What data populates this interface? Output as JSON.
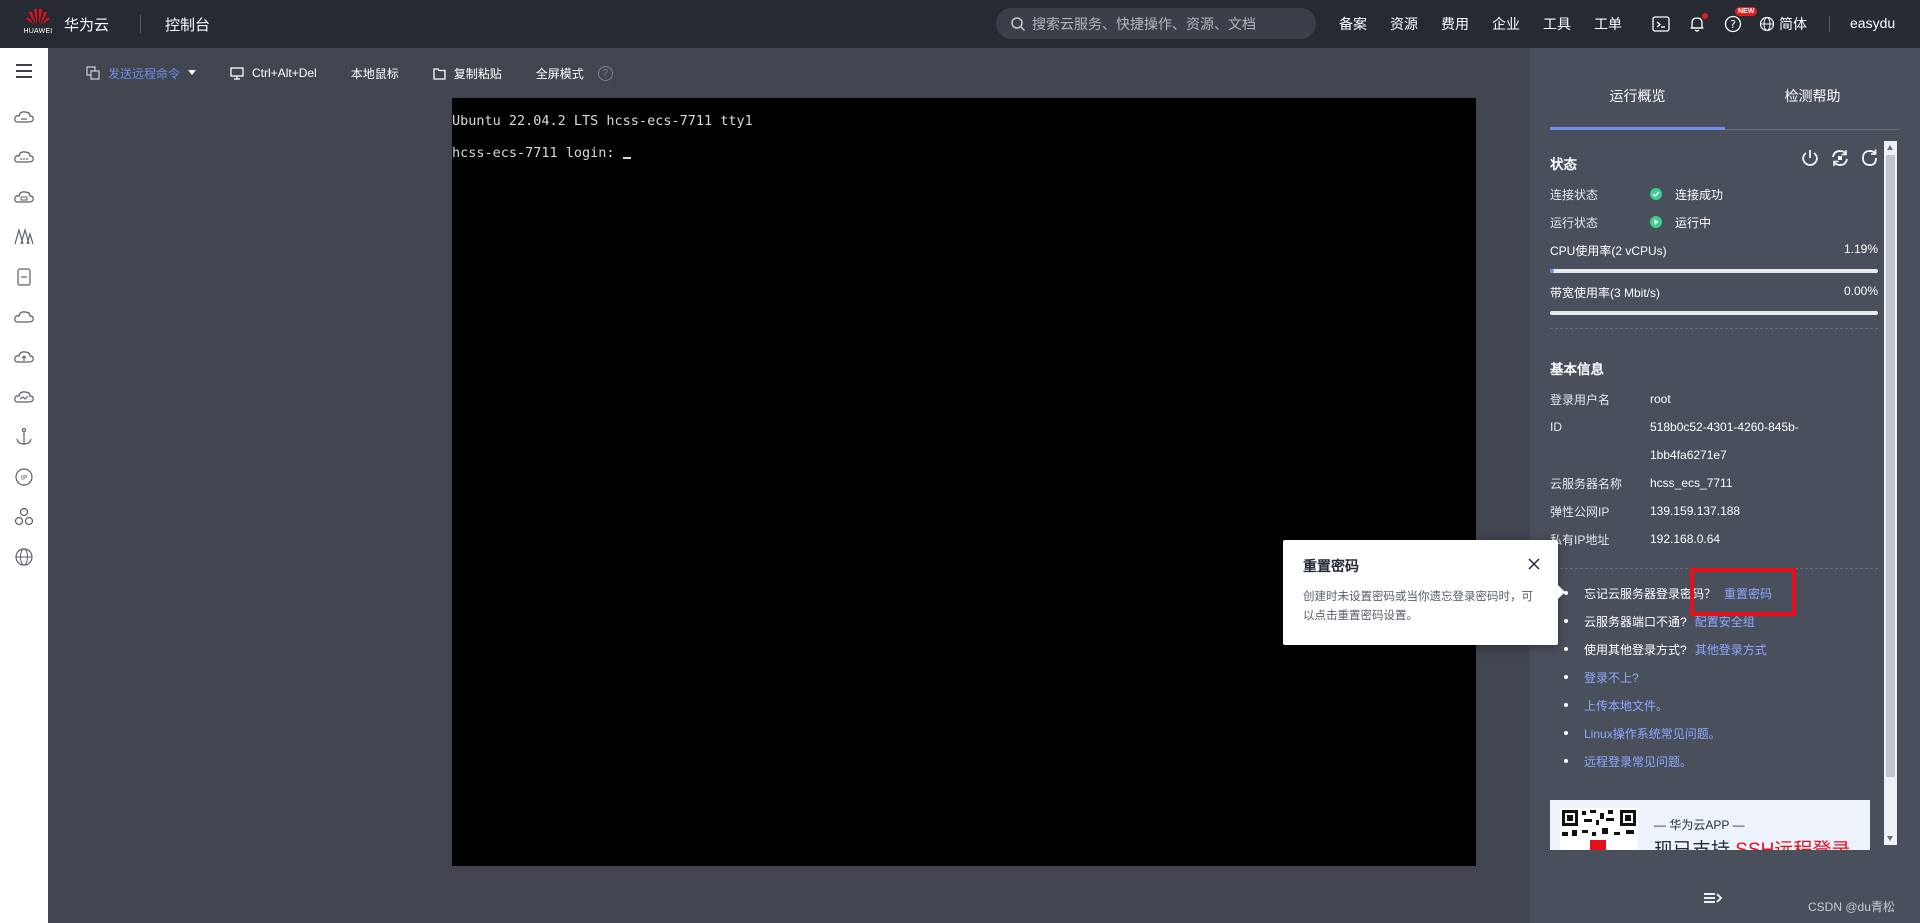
{
  "topbar": {
    "logo_word": "HUAWEI",
    "brand": "华为云",
    "console": "控制台",
    "search_placeholder": "搜索云服务、快捷操作、资源、文档",
    "nav": [
      "备案",
      "资源",
      "费用",
      "企业",
      "工具",
      "工单"
    ],
    "new_badge": "NEW",
    "language": "简体",
    "user": "easydu",
    "icons": [
      "terminal-icon",
      "bell-icon",
      "help-icon",
      "globe-icon"
    ]
  },
  "sidebar": {
    "icons": [
      "menu-icon",
      "cloud-server-icon",
      "cloud-icon",
      "cloud-container-icon",
      "network-icon",
      "storage-icon",
      "cloud-outline-icon",
      "cloud-upload-icon",
      "cloud-monitor-icon",
      "anchor-icon",
      "ip-icon",
      "cluster-icon",
      "globe-icon"
    ]
  },
  "toolbar": {
    "send_command": "发送远程命令",
    "ctrl_alt_del": "Ctrl+Alt+Del",
    "local_mouse": "本地鼠标",
    "copy_paste": "复制粘贴",
    "fullscreen": "全屏模式",
    "help": "?"
  },
  "terminal": {
    "line1": "Ubuntu 22.04.2 LTS hcss-ecs-7711 tty1",
    "line2": "hcss-ecs-7711 login: "
  },
  "popover": {
    "title": "重置密码",
    "text": "创建时未设置密码或当你遗忘登录密码时，可以点击重置密码设置。"
  },
  "panel": {
    "tabs": [
      "运行概览",
      "检测帮助"
    ],
    "status": {
      "title": "状态",
      "connection_label": "连接状态",
      "connection_value": "连接成功",
      "run_label": "运行状态",
      "run_value": "运行中",
      "cpu_label": "CPU使用率(2 vCPUs)",
      "cpu_value": "1.19%",
      "cpu_fraction": 0.0119,
      "bw_label": "带宽使用率(3 Mbit/s)",
      "bw_value": "0.00%",
      "bw_fraction": 0.0
    },
    "basic": {
      "title": "基本信息",
      "user_label": "登录用户名",
      "user_value": "root",
      "id_label": "ID",
      "id_value_1": "518b0c52-4301-4260-845b-",
      "id_value_2": "1bb4fa6271e7",
      "name_label": "云服务器名称",
      "name_value": "hcss_ecs_7711",
      "eip_label": "弹性公网IP",
      "eip_value": "139.159.137.188",
      "pip_label": "私有IP地址",
      "pip_value": "192.168.0.64"
    },
    "help": {
      "forgot_text": "忘记云服务器登录密码？",
      "forgot_link": "重置密码",
      "port_text": "云服务器端口不通?",
      "port_link": "配置安全组",
      "other_text": "使用其他登录方式?",
      "other_link": "其他登录方式",
      "login_fail": "登录不上?",
      "upload": "上传本地文件。",
      "linux_faq": "Linux操作系统常见问题。",
      "remote_faq": "远程登录常见问题。"
    },
    "promo": {
      "line1": "— 华为云APP —",
      "line2_prefix": "现已支持",
      "line2_red": "SSH远程登录"
    }
  },
  "watermark": "CSDN @du青松",
  "colors": {
    "accent": "#6d8ff0",
    "link": "#8ea8ff",
    "success": "#3ccf8e",
    "highlight": "#e5101c"
  }
}
